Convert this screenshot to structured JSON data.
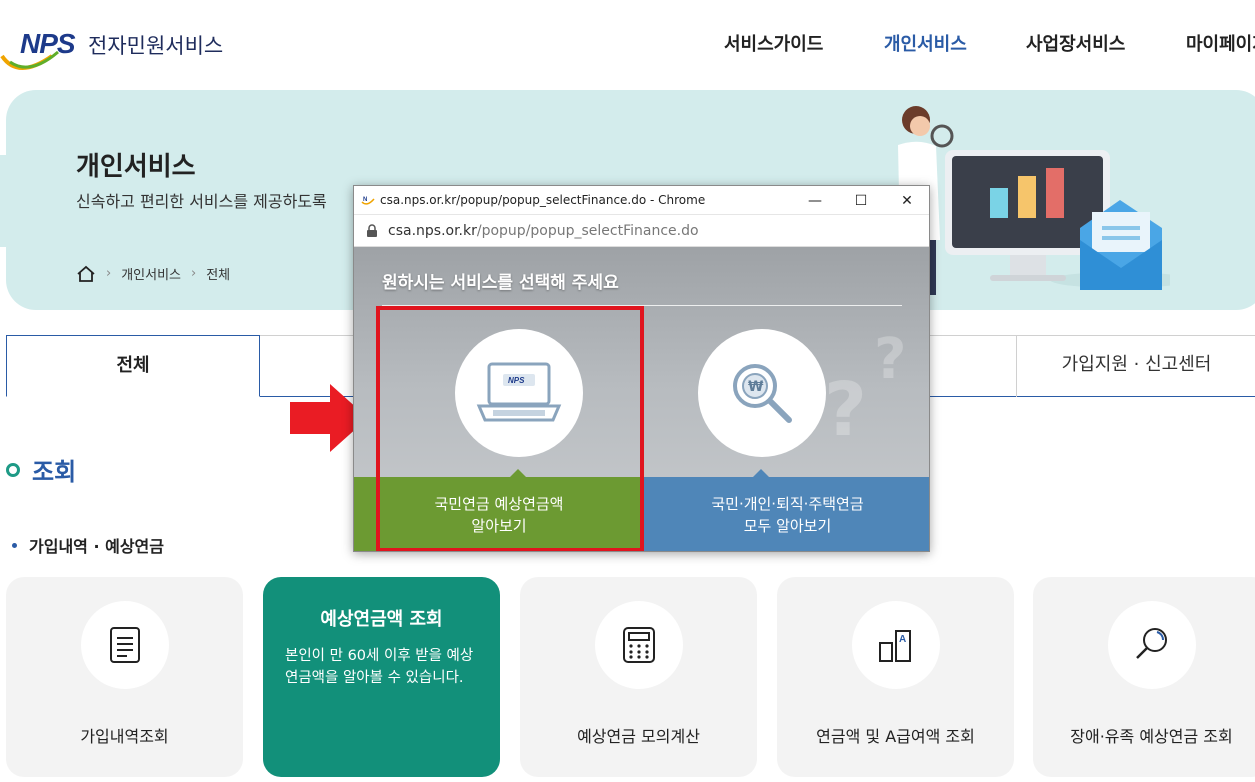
{
  "header": {
    "logo_mark": "NPS",
    "logo_text": "전자민원서비스",
    "nav": [
      "서비스가이드",
      "개인서비스",
      "사업장서비스",
      "마이페이지"
    ],
    "active_nav": "개인서비스"
  },
  "hero": {
    "title": "개인서비스",
    "subtitle": "신속하고 편리한 서비스를 제공하도록",
    "breadcrumb": [
      "개인서비스",
      "전체"
    ]
  },
  "tabs": {
    "active": "전체",
    "right": "가입지원 · 신고센터"
  },
  "section": {
    "title": "조회",
    "subtitle": "가입내역 · 예상연금"
  },
  "cards": [
    {
      "label": "가입내역조회",
      "icon": "document-icon"
    },
    {
      "title": "예상연금액 조회",
      "desc": "본인이 만 60세 이후 받을 예상연금액을 알아볼 수 있습니다.",
      "active": true
    },
    {
      "label": "예상연금 모의계산",
      "icon": "calculator-icon"
    },
    {
      "label": "연금액 및 A급여액 조회",
      "icon": "chart-a-icon"
    },
    {
      "label": "장애·유족 예상연금 조회",
      "icon": "magnifier-icon"
    }
  ],
  "popup": {
    "window_title": "csa.nps.or.kr/popup/popup_selectFinance.do - Chrome",
    "url_host": "csa.nps.or.kr",
    "url_path": "/popup/popup_selectFinance.do",
    "heading": "원하시는 서비스를 선택해 주세요",
    "option1_line1": "국민연금 예상연금액",
    "option1_line2": "알아보기",
    "option2_line1": "국민·개인·퇴직·주택연금",
    "option2_line2": "모두 알아보기",
    "minimize": "—",
    "maximize": "☐",
    "close": "✕"
  },
  "colors": {
    "brand_blue": "#2a5ba6",
    "teal": "#12907a",
    "hero_bg": "#d3ecec",
    "option1_green": "#6c9a32",
    "option2_blue": "#4f86b8",
    "highlight_red": "#e0141e"
  }
}
